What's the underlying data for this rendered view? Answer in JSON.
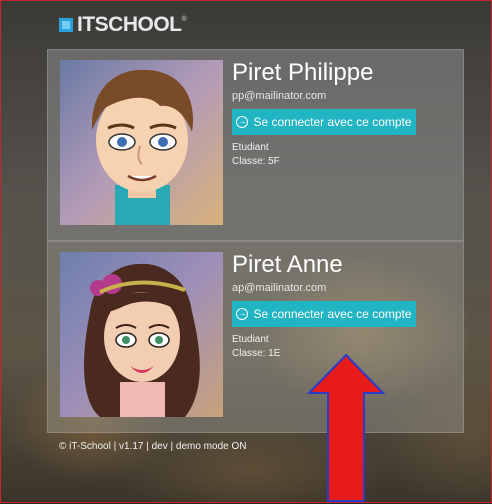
{
  "header": {
    "logo_text": "ITSCHOOL",
    "logo_reg": "®"
  },
  "accounts": [
    {
      "name": "Piret Philippe",
      "email": "pp@mailinator.com",
      "login_label": "Se connecter avec ce compte",
      "role": "Etudiant",
      "class_label": "Classe: 5F"
    },
    {
      "name": "Piret Anne",
      "email": "ap@mailinator.com",
      "login_label": "Se connecter avec ce compte",
      "role": "Etudiant",
      "class_label": "Classe: 1E"
    }
  ],
  "footer": {
    "text": "© iT-School | v1.17 | dev | demo mode ON"
  },
  "colors": {
    "accent": "#21b4c3",
    "annotation_arrow": "#e81b1b",
    "frame_border": "#c4262b"
  }
}
